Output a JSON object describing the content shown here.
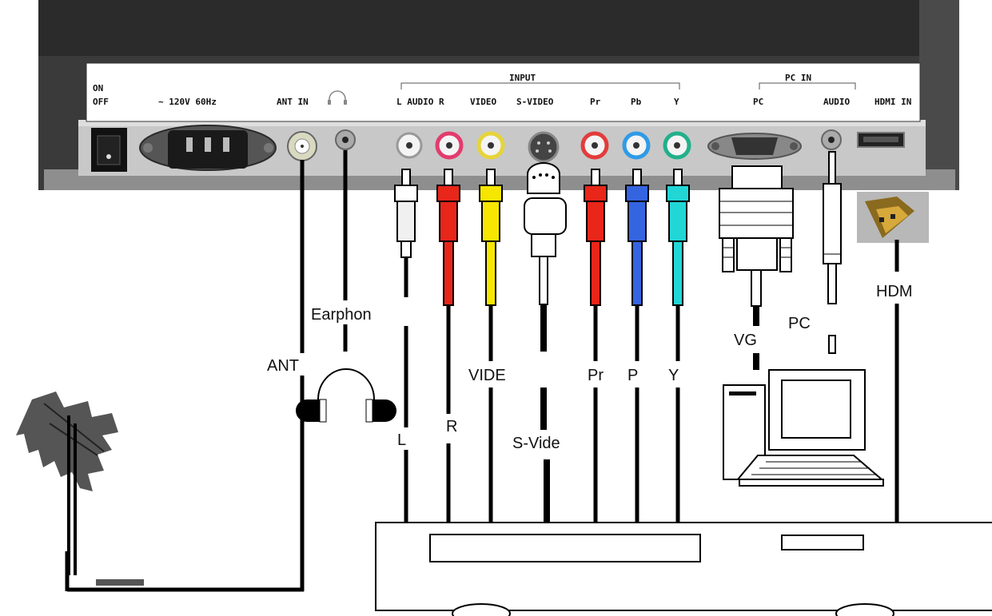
{
  "panel_labels": {
    "on": "ON",
    "off": "OFF",
    "power": "~ 120V 60Hz",
    "ant_in": "ANT IN",
    "input": "INPUT",
    "audio": "L AUDIO R",
    "video": "VIDEO",
    "svideo": "S-VIDEO",
    "pr": "Pr",
    "pb": "Pb",
    "y": "Y",
    "pc_in": "PC IN",
    "pc": "PC",
    "pc_audio": "AUDIO",
    "hdmi_in": "HDMI IN"
  },
  "cable_labels": {
    "earphone": "Earphon",
    "ant": "ANT",
    "l": "L",
    "r": "R",
    "video": "VIDE",
    "svideo": "S-Vide",
    "pr": "Pr",
    "pb": "P",
    "y": "Y",
    "vga": "VG",
    "pc": "PC",
    "hdmi": "HDM"
  },
  "icons": [
    "headphone-icon",
    "antenna-icon",
    "computer-icon",
    "hdmi-plug-icon",
    "vga-plug-icon",
    "rca-plug-icon",
    "svideo-plug-icon"
  ],
  "colors": {
    "rca_white": "#f0f0f0",
    "rca_red": "#e8261a",
    "rca_yellow": "#f7e600",
    "rca_blue": "#3464e0",
    "rca_cyan": "#22d6d6"
  }
}
